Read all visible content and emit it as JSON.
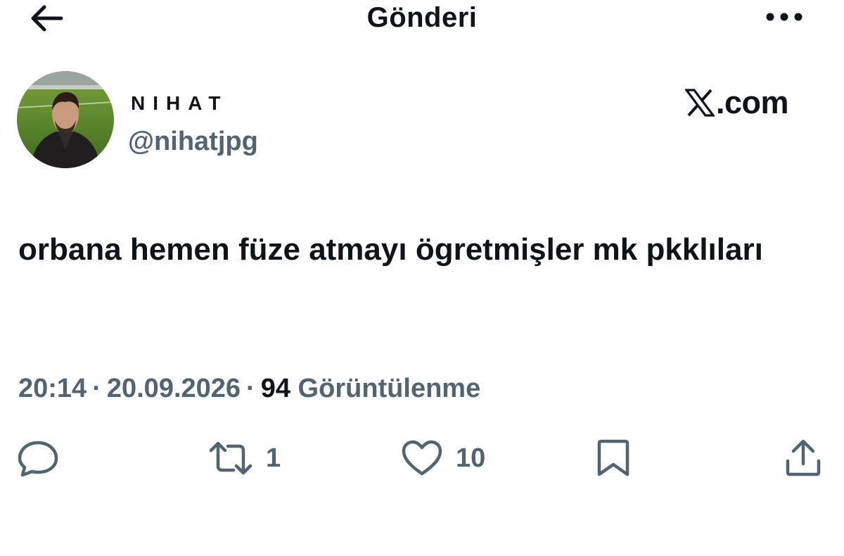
{
  "header": {
    "title": "Gönderi",
    "back_icon": "back-arrow-icon",
    "more_icon": "more-dots-icon"
  },
  "author": {
    "display_name": "NIHAT",
    "handle": "@nihatjpg",
    "avatar_icon": "avatar-photo"
  },
  "brand": {
    "text": ".com",
    "logo_icon": "x-logo-icon"
  },
  "tweet": {
    "text": "orbana hemen füze atmayı ögretmişler mk pkklıları"
  },
  "meta": {
    "time": "20:14",
    "separator": "·",
    "date": "20.09.2026",
    "views_count": "94",
    "views_label": "Görüntülenme"
  },
  "actions": {
    "reply": {
      "icon": "reply-icon",
      "count": ""
    },
    "repost": {
      "icon": "repost-icon",
      "count": "1"
    },
    "like": {
      "icon": "heart-icon",
      "count": "10"
    },
    "bookmark": {
      "icon": "bookmark-icon",
      "count": ""
    },
    "share": {
      "icon": "share-icon",
      "count": ""
    }
  },
  "colors": {
    "text_primary": "#0f1419",
    "text_secondary": "#536471",
    "background": "#ffffff"
  }
}
